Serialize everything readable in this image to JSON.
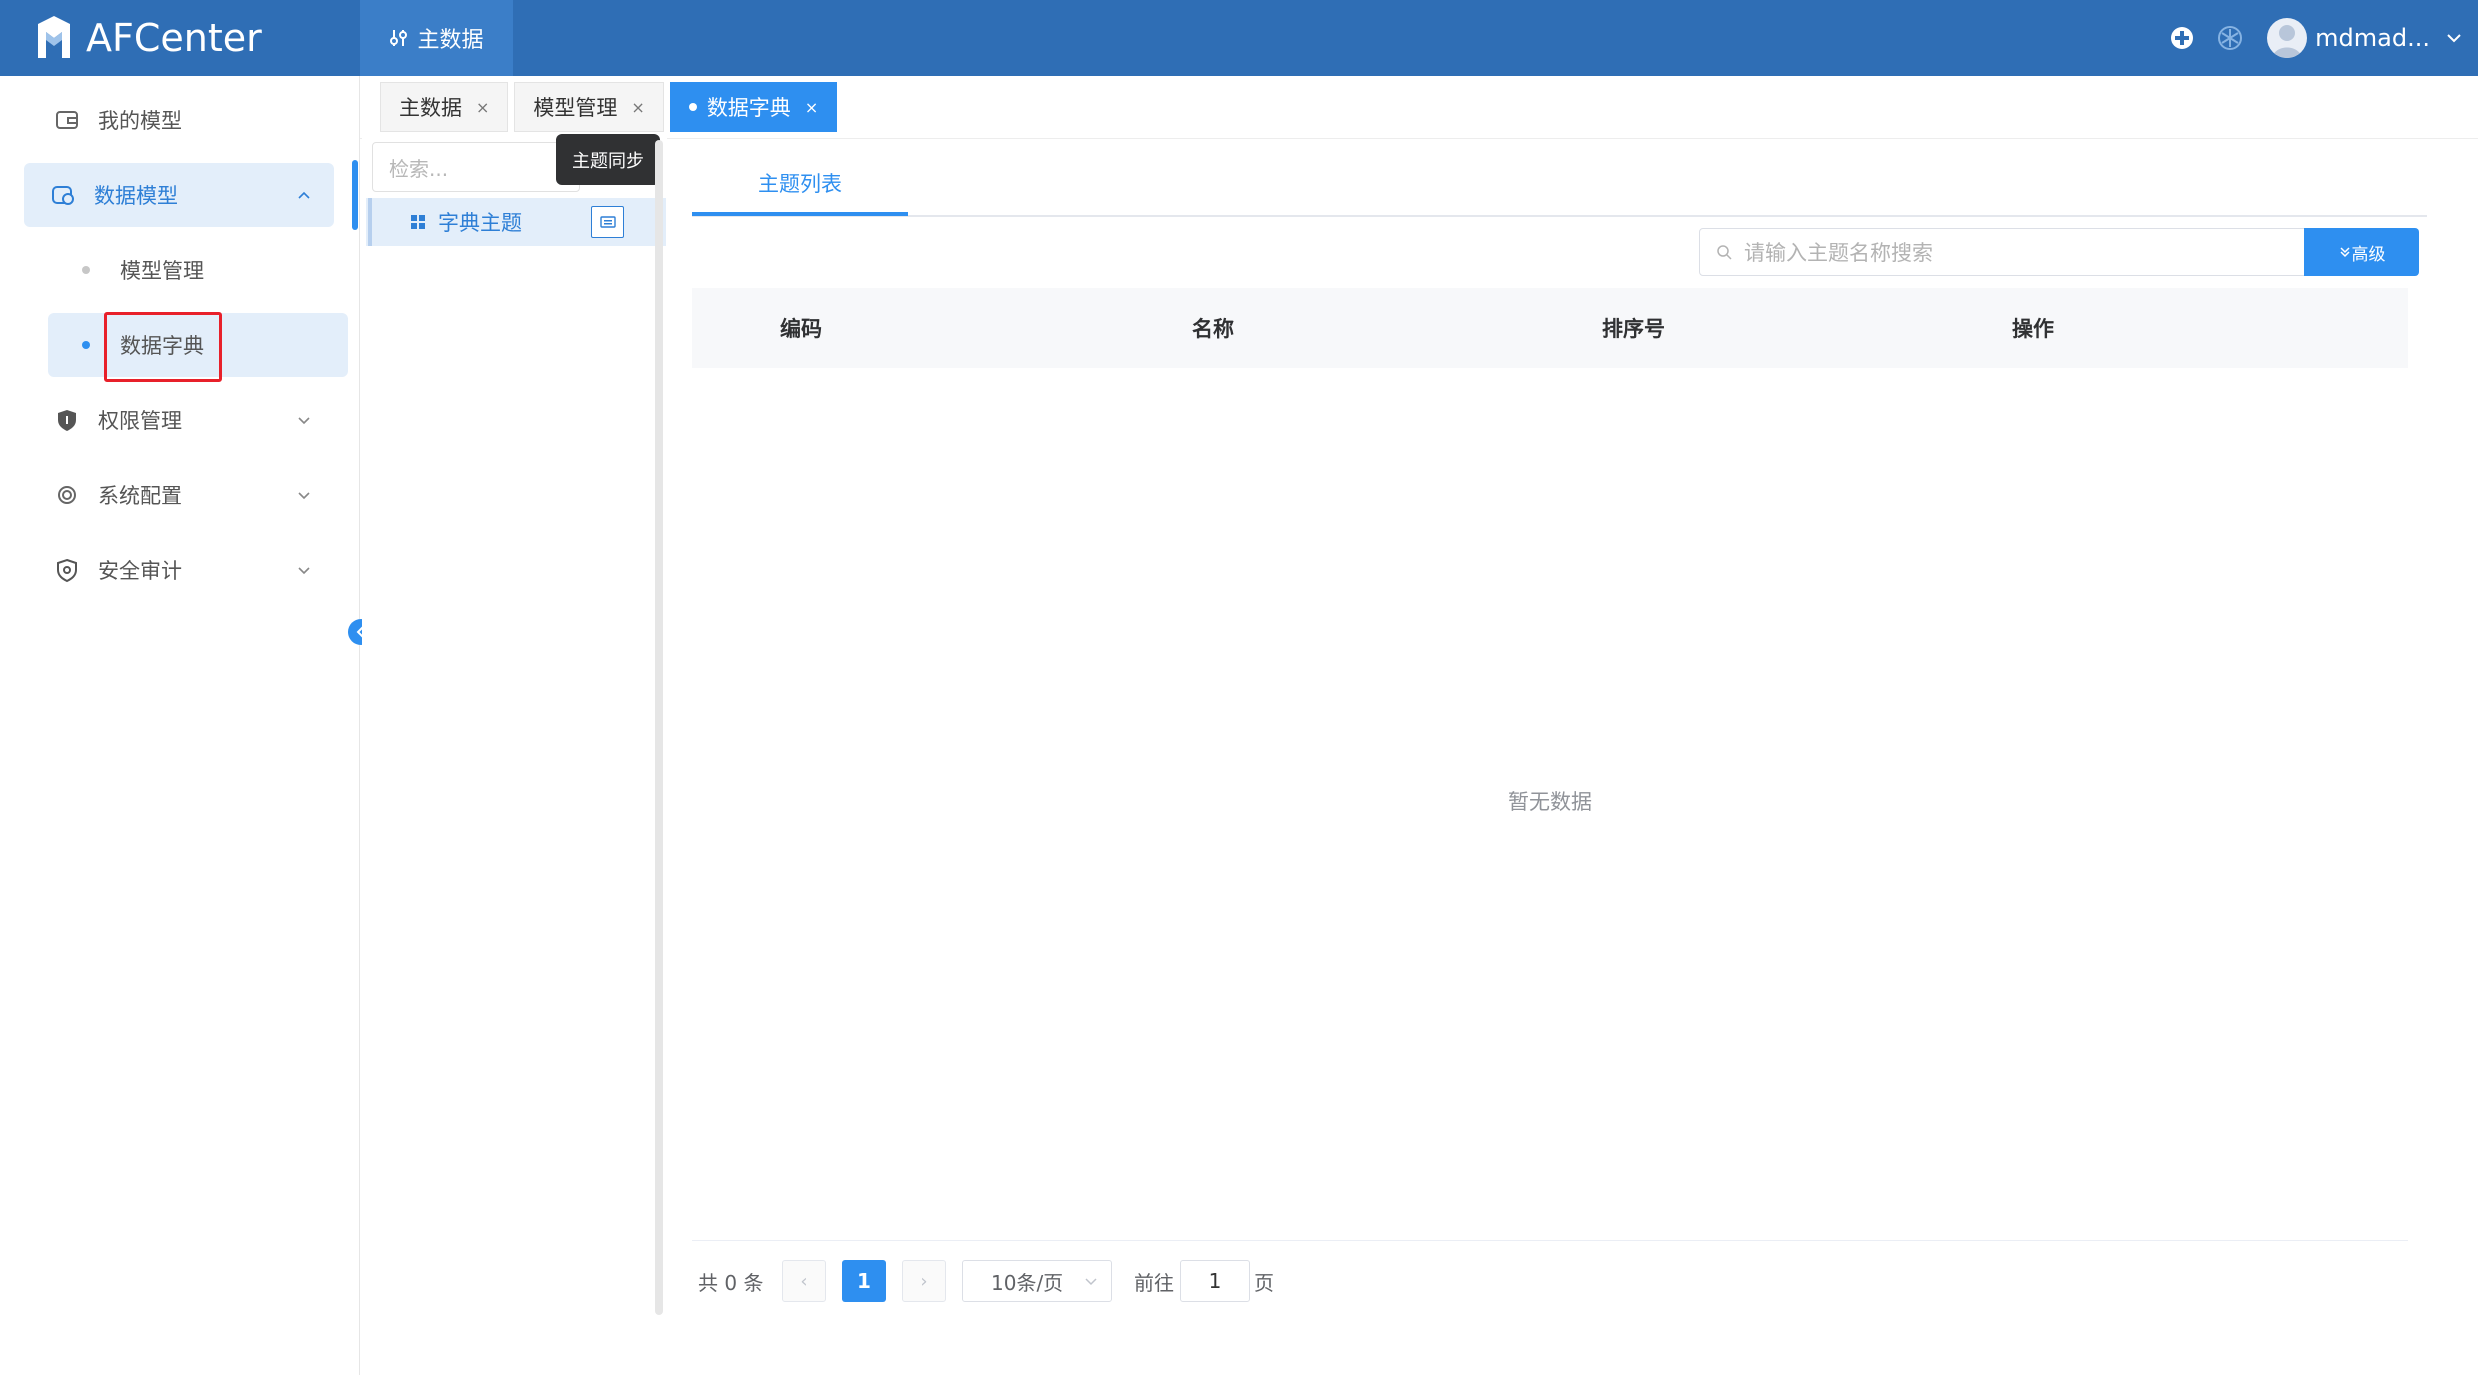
{
  "app": {
    "title": "AFCenter"
  },
  "top_nav": {
    "menu_label": "主数据",
    "user_name": "mdmad..."
  },
  "sidebar": {
    "items": [
      {
        "label": "我的模型"
      },
      {
        "label": "数据模型"
      },
      {
        "label": "权限管理"
      },
      {
        "label": "系统配置"
      },
      {
        "label": "安全审计"
      }
    ],
    "sub_items": [
      {
        "label": "模型管理"
      },
      {
        "label": "数据字典"
      }
    ]
  },
  "tabs": [
    {
      "label": "主数据",
      "close": "×"
    },
    {
      "label": "模型管理",
      "close": "×"
    },
    {
      "label": "数据字典",
      "close": "×"
    }
  ],
  "tree": {
    "search_placeholder": "检索...",
    "tooltip": "主题同步",
    "node_label": "字典主题"
  },
  "main": {
    "tab_label": "主题列表",
    "search_placeholder": "请输入主题名称搜索",
    "advanced_button": "高级",
    "columns": [
      "编码",
      "名称",
      "排序号",
      "操作"
    ],
    "empty_text": "暂无数据"
  },
  "pagination": {
    "total": "共 0 条",
    "current_page": "1",
    "page_size": "10条/页",
    "goto_label": "前往",
    "goto_value": "1",
    "page_suffix": "页",
    "prev": "‹",
    "next": "›"
  },
  "colors": {
    "header_blue": "#2f6eb5",
    "accent_blue": "#2e8ff0",
    "highlight_red": "#e8202a"
  }
}
